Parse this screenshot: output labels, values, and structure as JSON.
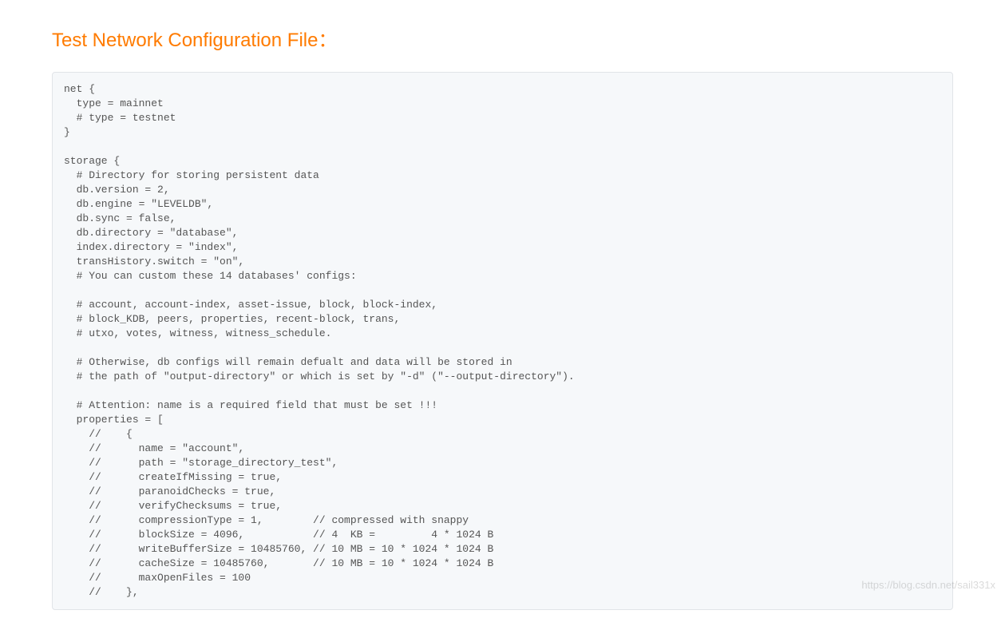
{
  "heading": "Test Network Configuration File：",
  "code": "net {\n  type = mainnet\n  # type = testnet\n}\n\nstorage {\n  # Directory for storing persistent data\n  db.version = 2,\n  db.engine = \"LEVELDB\",\n  db.sync = false,\n  db.directory = \"database\",\n  index.directory = \"index\",\n  transHistory.switch = \"on\",\n  # You can custom these 14 databases' configs:\n\n  # account, account-index, asset-issue, block, block-index,\n  # block_KDB, peers, properties, recent-block, trans,\n  # utxo, votes, witness, witness_schedule.\n\n  # Otherwise, db configs will remain defualt and data will be stored in\n  # the path of \"output-directory\" or which is set by \"-d\" (\"--output-directory\").\n\n  # Attention: name is a required field that must be set !!!\n  properties = [\n    //    {\n    //      name = \"account\",\n    //      path = \"storage_directory_test\",\n    //      createIfMissing = true,\n    //      paranoidChecks = true,\n    //      verifyChecksums = true,\n    //      compressionType = 1,        // compressed with snappy\n    //      blockSize = 4096,           // 4  KB =         4 * 1024 B\n    //      writeBufferSize = 10485760, // 10 MB = 10 * 1024 * 1024 B\n    //      cacheSize = 10485760,       // 10 MB = 10 * 1024 * 1024 B\n    //      maxOpenFiles = 100\n    //    },",
  "watermark": "https://blog.csdn.net/sail331x"
}
